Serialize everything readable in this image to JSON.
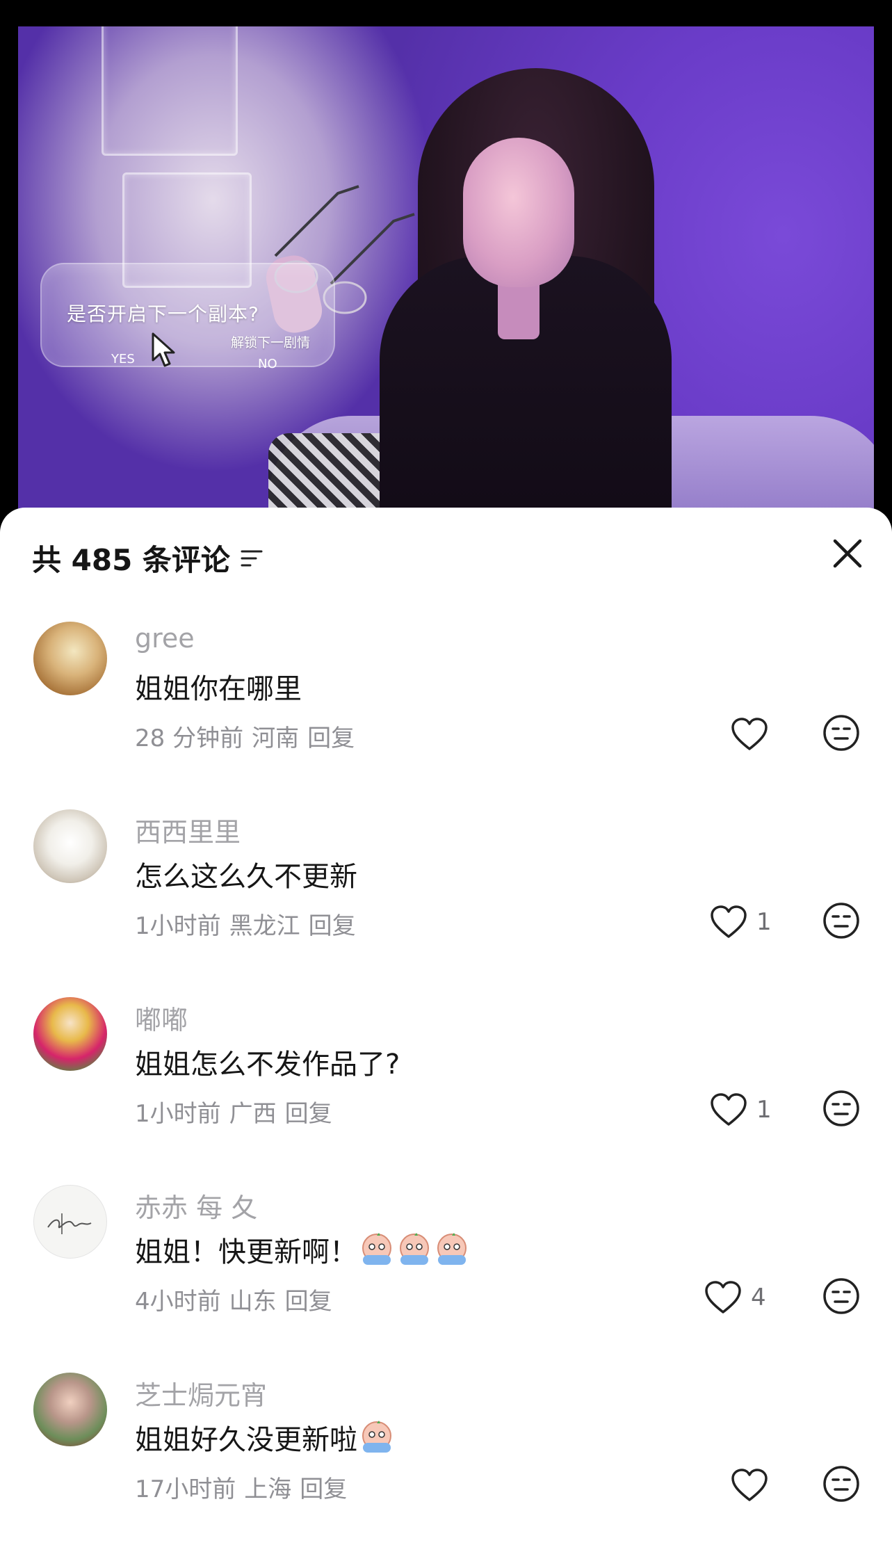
{
  "video": {
    "choice_question": "是否开启下一个副本?",
    "choice_sub": "解锁下一剧情",
    "choice_yes": "YES",
    "choice_no": "NO"
  },
  "comments_panel": {
    "title": "共 485 条评论",
    "sort_icon": "sort-lines-icon",
    "close_icon": "close-x-icon",
    "reply_label": "回复",
    "comments": [
      {
        "username": "gree",
        "text": "姐姐你在哪里",
        "time": "28 分钟前",
        "location": "河南",
        "likes": ""
      },
      {
        "username": "西西里里",
        "text": "怎么这么久不更新",
        "time": "1小时前",
        "location": "黑龙江",
        "likes": "1"
      },
      {
        "username": "嘟嘟",
        "text": "姐姐怎么不发作品了?",
        "time": "1小时前",
        "location": "广西",
        "likes": "1"
      },
      {
        "username": "赤赤 每 夂",
        "text": "姐姐！快更新啊！",
        "emojis": 3,
        "time": "4小时前",
        "location": "山东",
        "likes": "4"
      },
      {
        "username": "芝士焗元宵",
        "text": "姐姐好久没更新啦",
        "emojis": 1,
        "time": "17小时前",
        "location": "上海",
        "likes": ""
      }
    ]
  },
  "colors": {
    "video_purple": "#6b3ed0",
    "username_gray": "#a3a3a7",
    "meta_gray": "#8f8f94",
    "text_dark": "#161616"
  }
}
